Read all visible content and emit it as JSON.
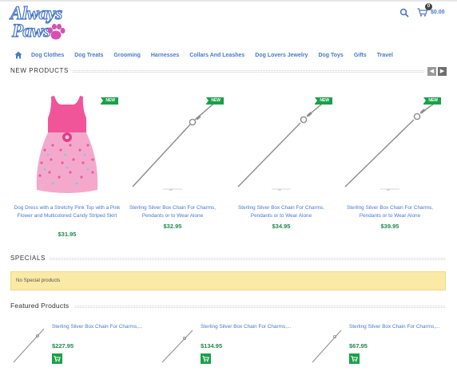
{
  "header": {
    "logo_line1": "Always",
    "logo_line2": "Paws",
    "cart_count": "0",
    "cart_total": "$0.00"
  },
  "nav": {
    "items": [
      "Dog Clothes",
      "Dog Treats",
      "Grooming",
      "Harnesses",
      "Collars And Leashes",
      "Dog Lovers Jewelry",
      "Dog Toys",
      "Gifts",
      "Travel"
    ]
  },
  "new_products": {
    "title": "NEW PRODUCTS",
    "items": [
      {
        "name": "Dog Dress with a Stretchy Pink Top with a Pink Flower and Multicolored Candy Striped Skirt",
        "price": "$31.95",
        "badge": "NEW"
      },
      {
        "name": "Sterling Silver Box Chain For Charms, Pendants or to Wear Alone",
        "price": "$32.95",
        "badge": "NEW"
      },
      {
        "name": "Sterling Silver Box Chain For Charms, Pendants or to Wear Alone",
        "price": "$34.95",
        "badge": "NEW"
      },
      {
        "name": "Sterling Silver Box Chain For Charms, Pendants or to Wear Alone",
        "price": "$39.95",
        "badge": "NEW"
      }
    ]
  },
  "specials": {
    "title": "SPECIALS",
    "message": "No Special products"
  },
  "featured": {
    "title": "Featured Products",
    "items": [
      {
        "name": "Sterling Silver Box Chain For Charms,...",
        "price": "$227.95"
      },
      {
        "name": "Sterling Silver Box Chain For Charms,...",
        "price": "$134.95"
      },
      {
        "name": "Sterling Silver Box Chain For Charms,...",
        "price": "$67.95"
      }
    ]
  },
  "colors": {
    "link_blue": "#4a78c9",
    "price_green": "#1f8a4a",
    "badge_green": "#1aa04a",
    "specials_bg": "#fbe9a6",
    "paw_pink": "#d94fb0"
  },
  "icons": [
    "search-icon",
    "cart-icon",
    "home-icon",
    "chevron-left-icon",
    "chevron-right-icon",
    "paw-icon",
    "add-to-cart-icon"
  ]
}
